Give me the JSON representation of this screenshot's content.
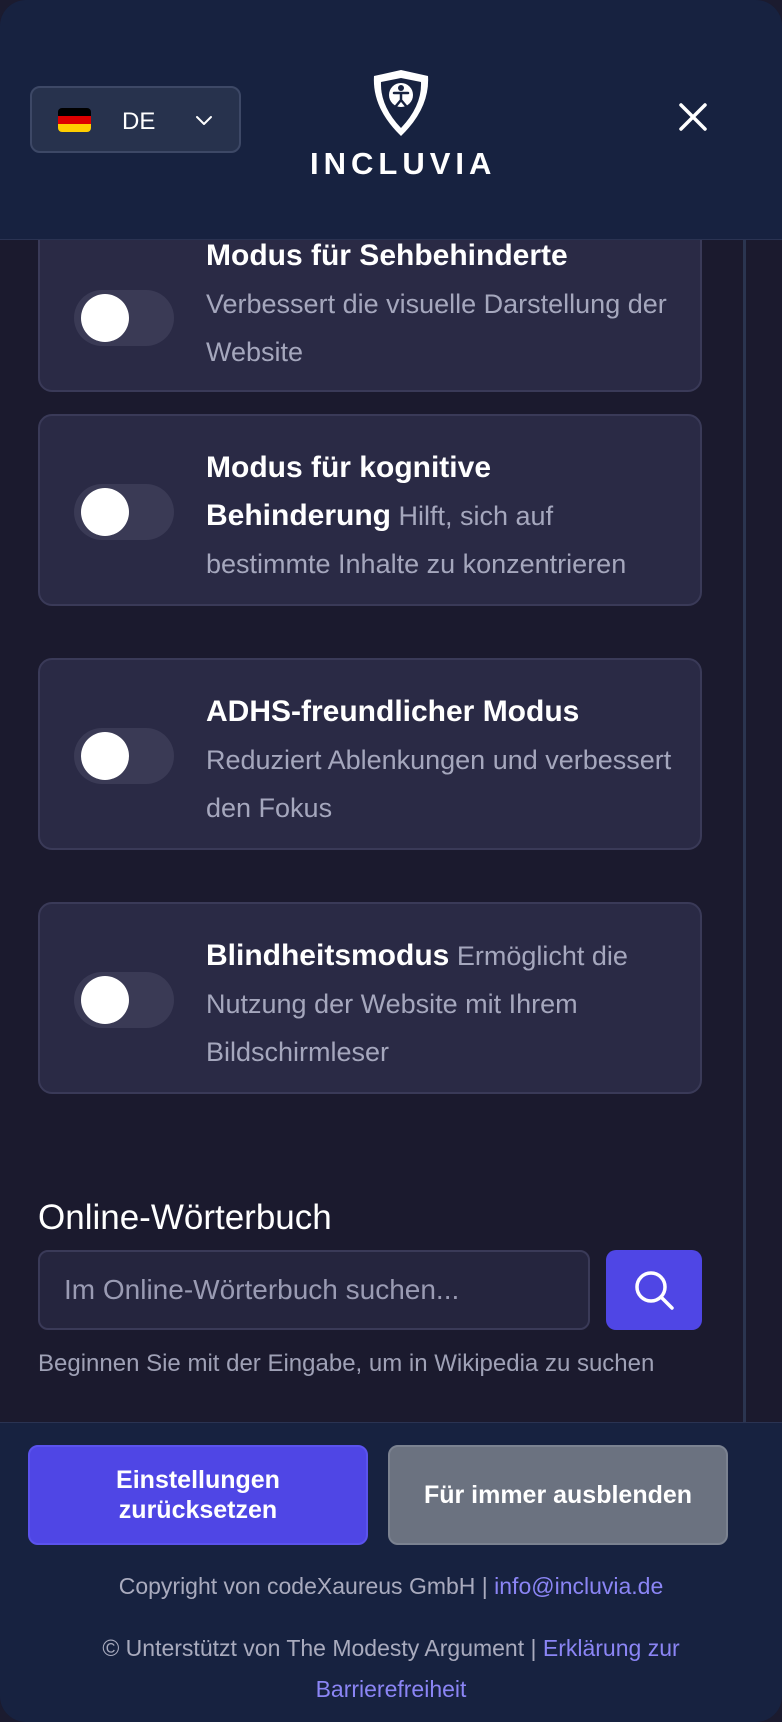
{
  "header": {
    "language_code": "DE",
    "brand": "INCLUVIA",
    "flag_colors": [
      "#000000",
      "#dd0000",
      "#ffce00"
    ]
  },
  "cards": [
    {
      "title": "Modus für Sehbehinderte",
      "description": "Verbessert die visuelle Darstellung der Website",
      "enabled": false
    },
    {
      "title": "Modus für kognitive Behinderung",
      "description": "Hilft, sich auf bestimmte Inhalte zu konzentrieren",
      "enabled": false
    },
    {
      "title": "ADHS-freundlicher Modus",
      "description": "Reduziert Ablenkungen und verbessert den Fokus",
      "enabled": false
    },
    {
      "title": "Blindheitsmodus",
      "description": "Ermöglicht die Nutzung der Website mit Ihrem Bildschirmleser",
      "enabled": false
    }
  ],
  "dictionary": {
    "title": "Online-Wörterbuch",
    "placeholder": "Im Online-Wörterbuch suchen...",
    "hint": "Beginnen Sie mit der Eingabe, um in Wikipedia zu suchen"
  },
  "footer": {
    "reset_line1": "Einstellungen",
    "reset_line2": "zurücksetzen",
    "hide_label": "Für immer ausblenden",
    "copyright_prefix": "Copyright von codeXaureus GmbH |",
    "email": "info@incluvia.de",
    "credit_prefix": "© Unterstützt von The Modesty Argument |",
    "accessibility_link": "Erklärung zur Barrierefreiheit"
  },
  "colors": {
    "accent": "#4f46e5",
    "header_bg": "#172240",
    "card_bg": "#2a2a45",
    "link": "#8b85f5"
  }
}
